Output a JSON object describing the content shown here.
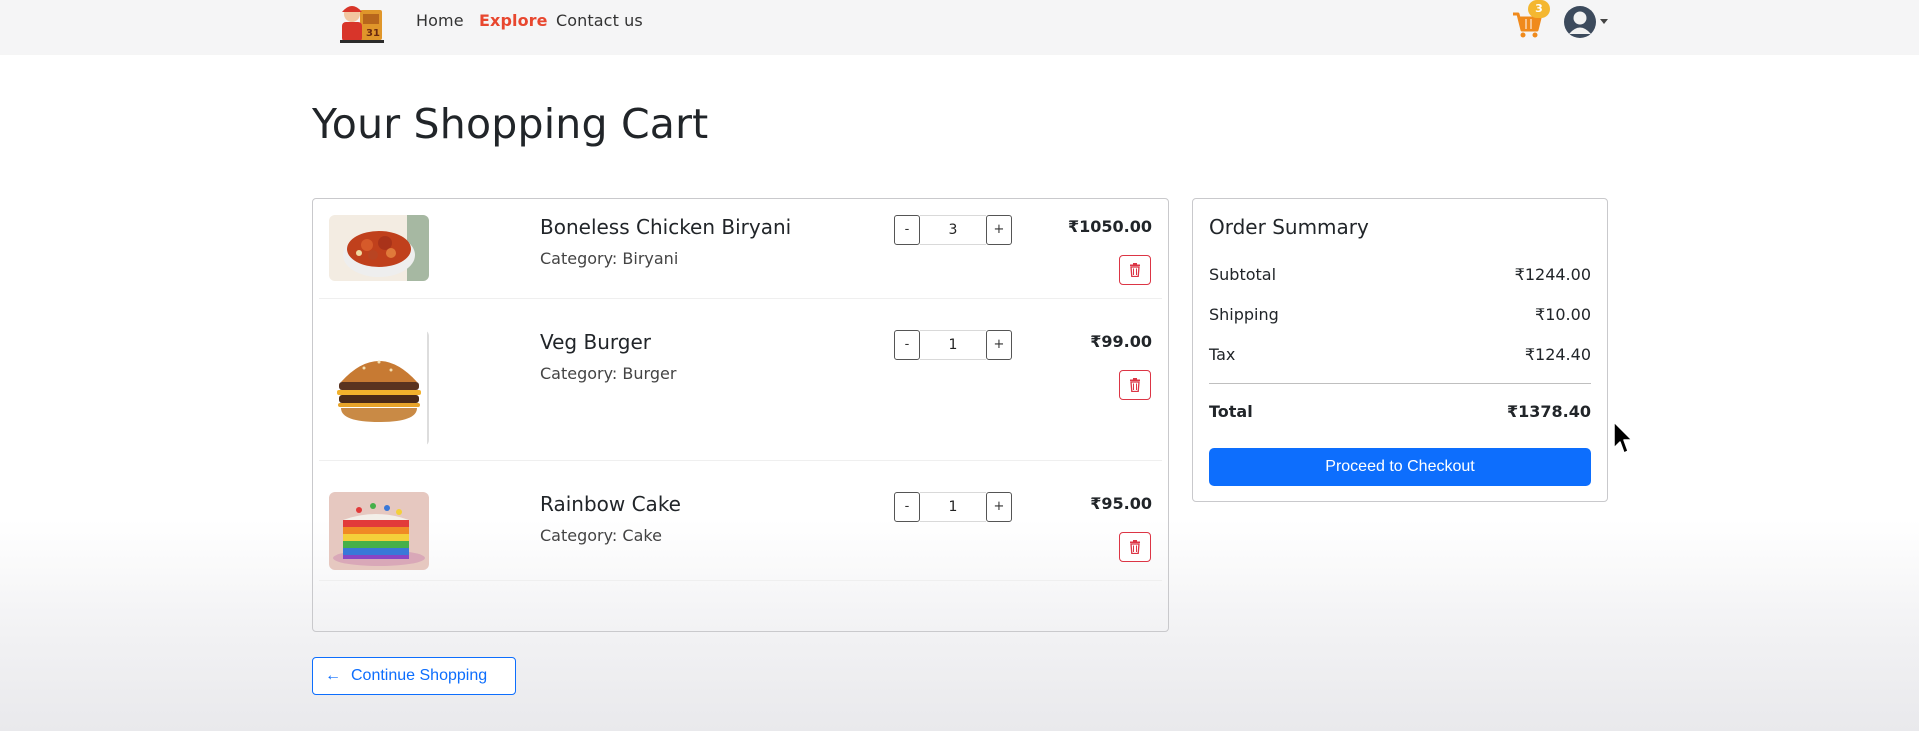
{
  "nav": {
    "links": [
      "Home",
      "Explore",
      "Contact us"
    ],
    "cart_count": "3",
    "icons": {
      "logo": "delivery-man-logo",
      "cart": "cart-icon",
      "avatar": "user-avatar-icon"
    }
  },
  "page": {
    "title": "Your Shopping Cart"
  },
  "cart": {
    "items": [
      {
        "name": "Boneless Chicken Biryani",
        "category": "Category: Biryani",
        "quantity": "3",
        "price": "₹1050.00",
        "image": "biryani-bowl"
      },
      {
        "name": "Veg Burger",
        "category": "Category: Burger",
        "quantity": "1",
        "price": "₹99.00",
        "image": "burger"
      },
      {
        "name": "Rainbow Cake",
        "category": "Category: Cake",
        "quantity": "1",
        "price": "₹95.00",
        "image": "rainbow-cake"
      }
    ],
    "minus_label": "-",
    "plus_label": "+"
  },
  "summary": {
    "title": "Order Summary",
    "subtotal_label": "Subtotal",
    "subtotal_value": "₹1244.00",
    "shipping_label": "Shipping",
    "shipping_value": "₹10.00",
    "tax_label": "Tax",
    "tax_value": "₹124.40",
    "total_label": "Total",
    "total_value": "₹1378.40",
    "checkout_label": "Proceed to Checkout"
  },
  "continue": {
    "label": "Continue Shopping",
    "arrow": "←"
  },
  "colors": {
    "accent": "#0d6efd",
    "explore": "#e8472f",
    "danger": "#dc3545",
    "badge": "#f4b731"
  }
}
